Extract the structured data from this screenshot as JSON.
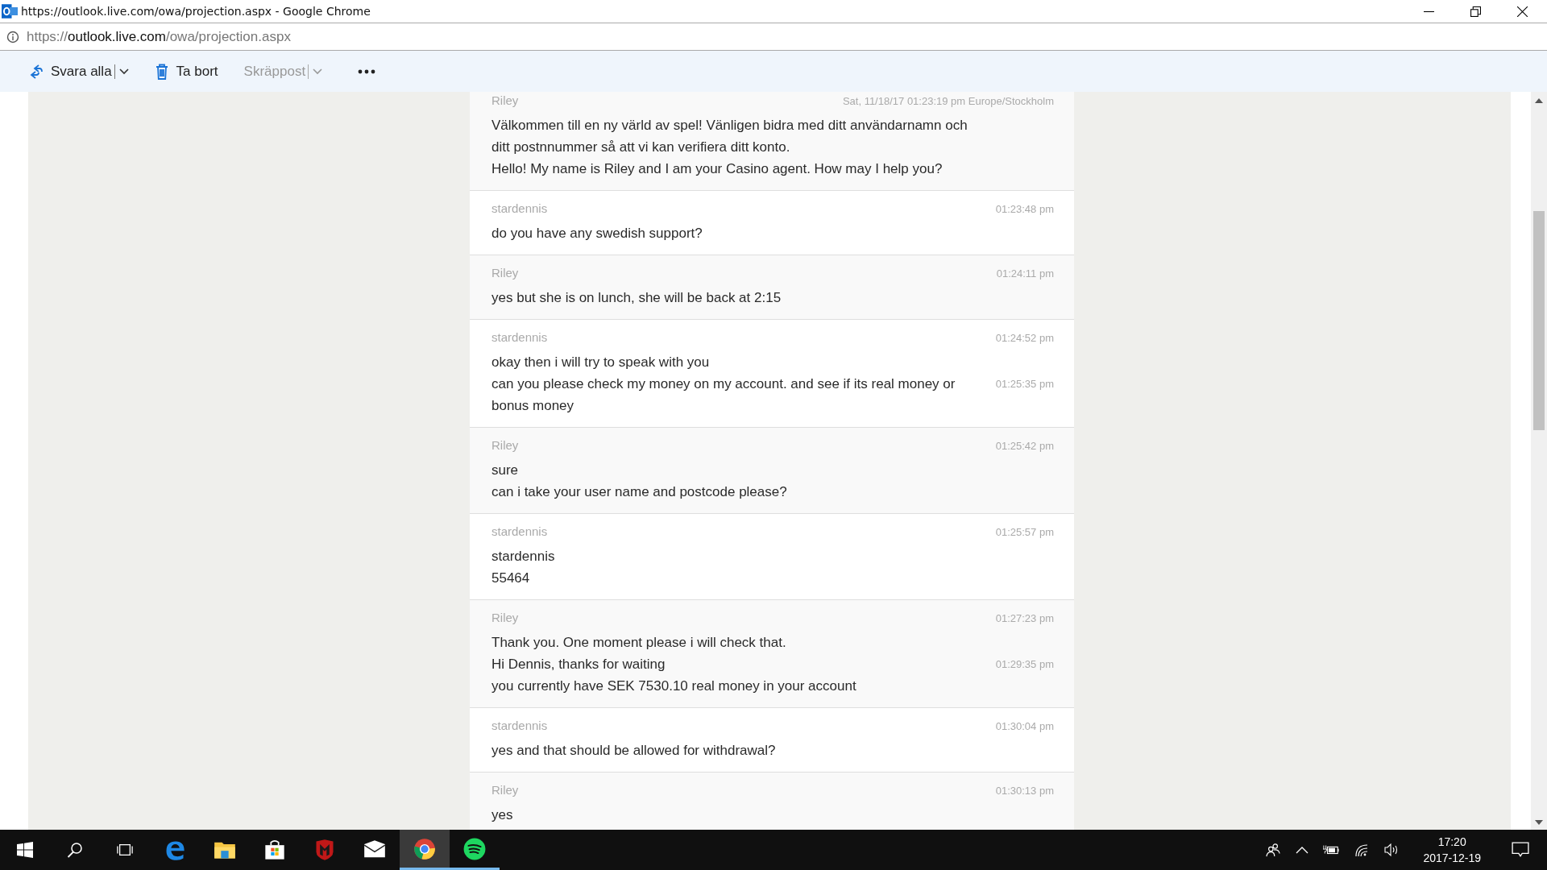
{
  "window": {
    "title": "https://outlook.live.com/owa/projection.aspx - Google Chrome"
  },
  "address": {
    "scheme": "https://",
    "host": "outlook.live.com",
    "path": "/owa/projection.aspx"
  },
  "toolbar": [
    {
      "kind": "reply-all",
      "label": "Svara alla",
      "disabled": false,
      "dropdown": true
    },
    {
      "kind": "delete",
      "label": "Ta bort",
      "disabled": false,
      "dropdown": false
    },
    {
      "kind": "junk",
      "label": "Skräppost",
      "disabled": true,
      "dropdown": true
    },
    {
      "kind": "more",
      "disabled": false,
      "dropdown": false
    }
  ],
  "messages": [
    {
      "kind": "agent",
      "sender": "Riley",
      "time": "Sat, 11/18/17 01:23:19 pm Europe/Stockholm",
      "lines": [
        {
          "text": "Välkommen till en ny värld av spel! Vänligen bidra med ditt användarnamn och ditt postnnummer så att vi kan verifiera ditt konto."
        },
        {
          "text": "Hello! My name is Riley and I am your Casino agent. How may I help you?"
        }
      ]
    },
    {
      "kind": "customer",
      "sender": "stardennis",
      "time": "01:23:48 pm",
      "lines": [
        {
          "text": "do you have any swedish support?"
        }
      ]
    },
    {
      "kind": "agent",
      "sender": "Riley",
      "time": "01:24:11 pm",
      "lines": [
        {
          "text": "yes but she is on lunch, she will be back at 2:15"
        }
      ]
    },
    {
      "kind": "customer",
      "sender": "stardennis",
      "time": "01:24:52 pm",
      "lines": [
        {
          "text": "okay then i will try to speak with you"
        },
        {
          "text": "can you please check my money on my account. and see if its real money or bonus money",
          "time": "01:25:35 pm"
        }
      ]
    },
    {
      "kind": "agent",
      "sender": "Riley",
      "time": "01:25:42 pm",
      "lines": [
        {
          "text": "sure"
        },
        {
          "text": "can i take your user name and postcode please?"
        }
      ]
    },
    {
      "kind": "customer",
      "sender": "stardennis",
      "time": "01:25:57 pm",
      "lines": [
        {
          "text": "stardennis"
        },
        {
          "text": "55464"
        }
      ]
    },
    {
      "kind": "agent",
      "sender": "Riley",
      "time": "01:27:23 pm",
      "lines": [
        {
          "text": "Thank you. One moment please i will check that."
        },
        {
          "text": "Hi Dennis, thanks for waiting",
          "time": "01:29:35 pm"
        },
        {
          "text": "you currently have SEK 7530.10 real money in your account"
        }
      ]
    },
    {
      "kind": "customer",
      "sender": "stardennis",
      "time": "01:30:04 pm",
      "lines": [
        {
          "text": "yes and that should be allowed for withdrawal?"
        }
      ]
    },
    {
      "kind": "agent",
      "sender": "Riley",
      "time": "01:30:13 pm",
      "lines": [
        {
          "text": "yes"
        }
      ]
    }
  ],
  "taskbar": [
    {
      "kind": "start",
      "active": false,
      "running": false
    },
    {
      "kind": "search",
      "active": false,
      "running": false
    },
    {
      "kind": "task-view",
      "active": false,
      "running": false
    },
    {
      "kind": "edge",
      "active": false,
      "running": false
    },
    {
      "kind": "explorer",
      "active": false,
      "running": false
    },
    {
      "kind": "store",
      "active": false,
      "running": false
    },
    {
      "kind": "shield",
      "active": false,
      "running": false
    },
    {
      "kind": "mail",
      "active": false,
      "running": false
    },
    {
      "kind": "chrome",
      "active": true,
      "running": true
    },
    {
      "kind": "spotify",
      "active": false,
      "running": true
    }
  ],
  "clock": {
    "time": "17:20",
    "date": "2017-12-19"
  }
}
